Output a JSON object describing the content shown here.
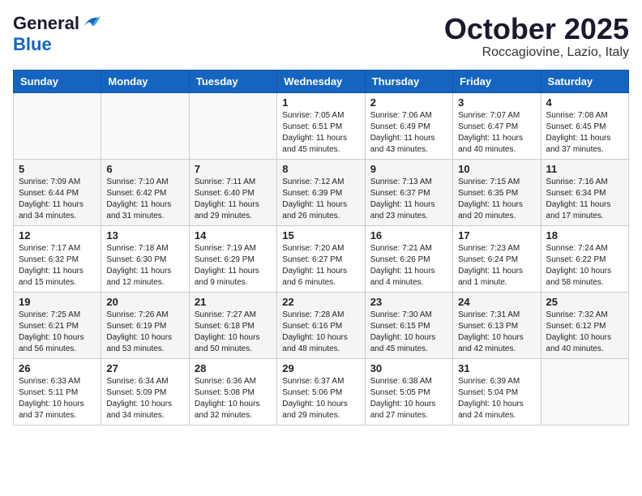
{
  "header": {
    "logo_general": "General",
    "logo_blue": "Blue",
    "month": "October 2025",
    "location": "Roccagiovine, Lazio, Italy"
  },
  "days_of_week": [
    "Sunday",
    "Monday",
    "Tuesday",
    "Wednesday",
    "Thursday",
    "Friday",
    "Saturday"
  ],
  "weeks": [
    [
      {
        "day": "",
        "info": ""
      },
      {
        "day": "",
        "info": ""
      },
      {
        "day": "",
        "info": ""
      },
      {
        "day": "1",
        "info": "Sunrise: 7:05 AM\nSunset: 6:51 PM\nDaylight: 11 hours and 45 minutes."
      },
      {
        "day": "2",
        "info": "Sunrise: 7:06 AM\nSunset: 6:49 PM\nDaylight: 11 hours and 43 minutes."
      },
      {
        "day": "3",
        "info": "Sunrise: 7:07 AM\nSunset: 6:47 PM\nDaylight: 11 hours and 40 minutes."
      },
      {
        "day": "4",
        "info": "Sunrise: 7:08 AM\nSunset: 6:45 PM\nDaylight: 11 hours and 37 minutes."
      }
    ],
    [
      {
        "day": "5",
        "info": "Sunrise: 7:09 AM\nSunset: 6:44 PM\nDaylight: 11 hours and 34 minutes."
      },
      {
        "day": "6",
        "info": "Sunrise: 7:10 AM\nSunset: 6:42 PM\nDaylight: 11 hours and 31 minutes."
      },
      {
        "day": "7",
        "info": "Sunrise: 7:11 AM\nSunset: 6:40 PM\nDaylight: 11 hours and 29 minutes."
      },
      {
        "day": "8",
        "info": "Sunrise: 7:12 AM\nSunset: 6:39 PM\nDaylight: 11 hours and 26 minutes."
      },
      {
        "day": "9",
        "info": "Sunrise: 7:13 AM\nSunset: 6:37 PM\nDaylight: 11 hours and 23 minutes."
      },
      {
        "day": "10",
        "info": "Sunrise: 7:15 AM\nSunset: 6:35 PM\nDaylight: 11 hours and 20 minutes."
      },
      {
        "day": "11",
        "info": "Sunrise: 7:16 AM\nSunset: 6:34 PM\nDaylight: 11 hours and 17 minutes."
      }
    ],
    [
      {
        "day": "12",
        "info": "Sunrise: 7:17 AM\nSunset: 6:32 PM\nDaylight: 11 hours and 15 minutes."
      },
      {
        "day": "13",
        "info": "Sunrise: 7:18 AM\nSunset: 6:30 PM\nDaylight: 11 hours and 12 minutes."
      },
      {
        "day": "14",
        "info": "Sunrise: 7:19 AM\nSunset: 6:29 PM\nDaylight: 11 hours and 9 minutes."
      },
      {
        "day": "15",
        "info": "Sunrise: 7:20 AM\nSunset: 6:27 PM\nDaylight: 11 hours and 6 minutes."
      },
      {
        "day": "16",
        "info": "Sunrise: 7:21 AM\nSunset: 6:26 PM\nDaylight: 11 hours and 4 minutes."
      },
      {
        "day": "17",
        "info": "Sunrise: 7:23 AM\nSunset: 6:24 PM\nDaylight: 11 hours and 1 minute."
      },
      {
        "day": "18",
        "info": "Sunrise: 7:24 AM\nSunset: 6:22 PM\nDaylight: 10 hours and 58 minutes."
      }
    ],
    [
      {
        "day": "19",
        "info": "Sunrise: 7:25 AM\nSunset: 6:21 PM\nDaylight: 10 hours and 56 minutes."
      },
      {
        "day": "20",
        "info": "Sunrise: 7:26 AM\nSunset: 6:19 PM\nDaylight: 10 hours and 53 minutes."
      },
      {
        "day": "21",
        "info": "Sunrise: 7:27 AM\nSunset: 6:18 PM\nDaylight: 10 hours and 50 minutes."
      },
      {
        "day": "22",
        "info": "Sunrise: 7:28 AM\nSunset: 6:16 PM\nDaylight: 10 hours and 48 minutes."
      },
      {
        "day": "23",
        "info": "Sunrise: 7:30 AM\nSunset: 6:15 PM\nDaylight: 10 hours and 45 minutes."
      },
      {
        "day": "24",
        "info": "Sunrise: 7:31 AM\nSunset: 6:13 PM\nDaylight: 10 hours and 42 minutes."
      },
      {
        "day": "25",
        "info": "Sunrise: 7:32 AM\nSunset: 6:12 PM\nDaylight: 10 hours and 40 minutes."
      }
    ],
    [
      {
        "day": "26",
        "info": "Sunrise: 6:33 AM\nSunset: 5:11 PM\nDaylight: 10 hours and 37 minutes."
      },
      {
        "day": "27",
        "info": "Sunrise: 6:34 AM\nSunset: 5:09 PM\nDaylight: 10 hours and 34 minutes."
      },
      {
        "day": "28",
        "info": "Sunrise: 6:36 AM\nSunset: 5:08 PM\nDaylight: 10 hours and 32 minutes."
      },
      {
        "day": "29",
        "info": "Sunrise: 6:37 AM\nSunset: 5:06 PM\nDaylight: 10 hours and 29 minutes."
      },
      {
        "day": "30",
        "info": "Sunrise: 6:38 AM\nSunset: 5:05 PM\nDaylight: 10 hours and 27 minutes."
      },
      {
        "day": "31",
        "info": "Sunrise: 6:39 AM\nSunset: 5:04 PM\nDaylight: 10 hours and 24 minutes."
      },
      {
        "day": "",
        "info": ""
      }
    ]
  ]
}
